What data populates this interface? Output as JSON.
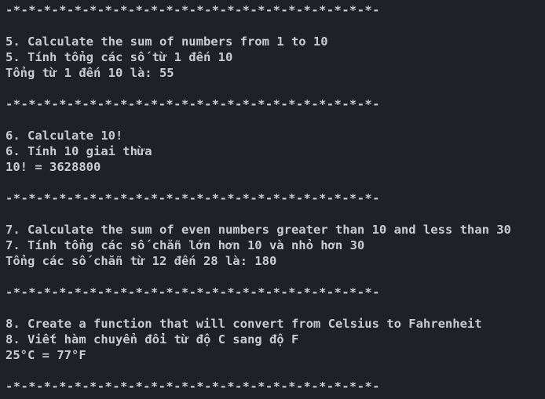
{
  "terminal": {
    "separator": "-*-*-*-*-*-*-*-*-*-*-*-*-*-*-*-*-*-*-*-*-*-*-*-*-",
    "sections": [
      {
        "title_en": "5. Calculate the sum of numbers from 1 to 10",
        "title_vi": "5. Tính tổng các số từ 1 đến 10",
        "result": "Tổng từ 1 đến 10 là: 55"
      },
      {
        "title_en": "6. Calculate 10!",
        "title_vi": "6. Tính 10 giai thừa",
        "result": "10! = 3628800"
      },
      {
        "title_en": "7. Calculate the sum of even numbers greater than 10 and less than 30",
        "title_vi": "7. Tính tổng các số chẵn lớn hơn 10 và nhỏ hơn 30",
        "result": "Tổng các số chẵn từ 12 đến 28 là: 180"
      },
      {
        "title_en": "8. Create a function that will convert from Celsius to Fahrenheit",
        "title_vi": "8. Viết hàm chuyển đổi từ độ C sang độ F",
        "result": "25°C = 77°F"
      }
    ]
  }
}
